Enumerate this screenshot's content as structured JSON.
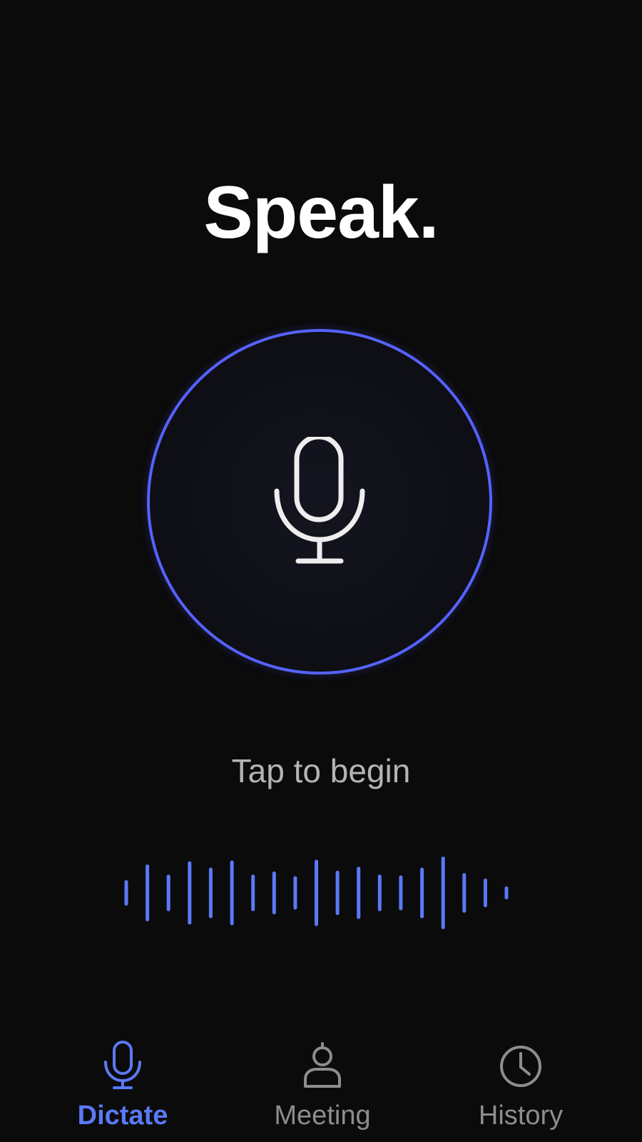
{
  "header": {
    "title": "Speak."
  },
  "record": {
    "icon": "microphone-icon",
    "accent_color": "#5662ff",
    "hint": "Tap to begin"
  },
  "waveform": {
    "color": "#5b79f5",
    "levels": [
      0.28,
      0.68,
      0.42,
      0.76,
      0.6,
      0.78,
      0.42,
      0.5,
      0.38,
      0.8,
      0.52,
      0.62,
      0.42,
      0.4,
      0.6,
      0.88,
      0.46,
      0.32,
      0.12
    ]
  },
  "tabbar": {
    "active_color": "#5b79f5",
    "inactive_color": "#8d8d90",
    "tabs": [
      {
        "label": "Dictate",
        "icon": "microphone-icon",
        "active": true
      },
      {
        "label": "Meeting",
        "icon": "person-icon",
        "active": false
      },
      {
        "label": "History",
        "icon": "clock-icon",
        "active": false
      }
    ]
  }
}
